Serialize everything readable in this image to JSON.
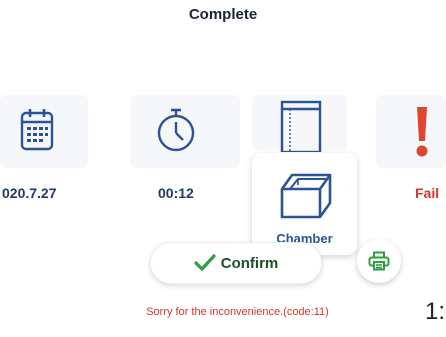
{
  "header": {
    "title": "Complete"
  },
  "status": {
    "date": "020.7.27",
    "elapsed": "00:12",
    "result": "Fail"
  },
  "chamber": {
    "label": "Chamber"
  },
  "actions": {
    "confirm_label": "Confirm"
  },
  "error": {
    "message": "Sorry for the inconvenience.(code:11)"
  },
  "edge_text": "1:",
  "colors": {
    "accent": "#2b5396",
    "fail": "#d3362a",
    "confirm_check": "#2e9e3e",
    "print_icon": "#2e9e3e"
  },
  "icons": [
    "calendar-icon",
    "stopwatch-icon",
    "door-icon",
    "exclamation-icon",
    "chamber-icon",
    "check-icon",
    "printer-icon"
  ]
}
